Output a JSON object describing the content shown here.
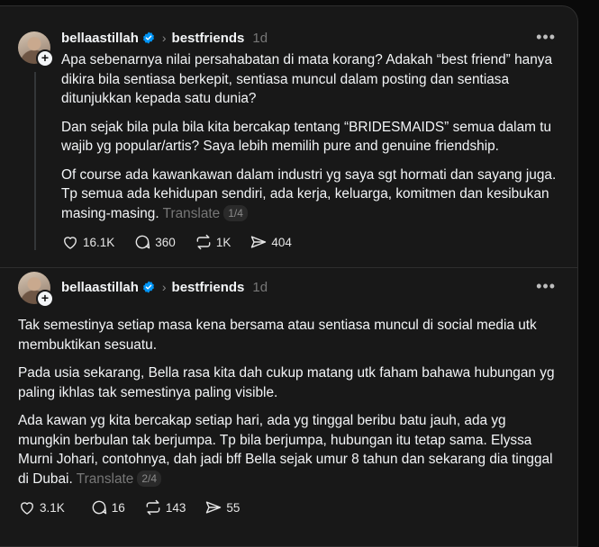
{
  "posts": [
    {
      "username": "bellaastillah",
      "community": "bestfriends",
      "time": "1d",
      "paragraphs": [
        "Apa sebenarnya nilai persahabatan di mata korang? Adakah “best friend” hanya dikira bila sentiasa berkepit, sentiasa muncul dalam posting dan sentiasa ditunjukkan kepada satu dunia?",
        "Dan sejak bila pula bila kita bercakap tentang “BRIDESMAIDS” semua dalam tu wajib yg popular/artis? Saya lebih memilih pure and genuine friendship.",
        "Of course ada kawankawan dalam industri yg saya sgt hormati dan sayang juga. Tp semua ada kehidupan sendiri, ada kerja, keluarga, komitmen dan kesibukan masing-masing."
      ],
      "translate": "Translate",
      "counter": "1/4",
      "likes": "16.1K",
      "replies": "360",
      "reposts": "1K",
      "shares": "404"
    },
    {
      "username": "bellaastillah",
      "community": "bestfriends",
      "time": "1d",
      "paragraphs": [
        "Tak semestinya setiap masa kena bersama atau sentiasa muncul di social media utk membuktikan sesuatu.",
        "Pada usia sekarang, Bella rasa kita dah cukup matang utk faham bahawa hubungan yg paling ikhlas tak semestinya paling visible.",
        "Ada kawan yg kita bercakap setiap hari, ada yg tinggal beribu batu jauh, ada yg mungkin berbulan tak berjumpa. Tp bila berjumpa, hubungan itu tetap sama. Elyssa Murni Johari, contohnya, dah jadi bff Bella sejak umur 8 tahun dan sekarang dia tinggal di Dubai."
      ],
      "translate": "Translate",
      "counter": "2/4",
      "likes": "3.1K",
      "replies": "16",
      "reposts": "143",
      "shares": "55"
    }
  ],
  "icons": {
    "verified": "verified-badge-icon",
    "chevron": "chevron-right-icon",
    "more": "more-horizontal-icon",
    "like": "heart-icon",
    "reply": "comment-icon",
    "repost": "repost-icon",
    "share": "share-icon"
  },
  "colors": {
    "background": "#181818",
    "page": "#0a0a0a",
    "text": "#f3f5f7",
    "muted": "#777777",
    "verified": "#0095f6",
    "divider": "#2e2e2e"
  }
}
